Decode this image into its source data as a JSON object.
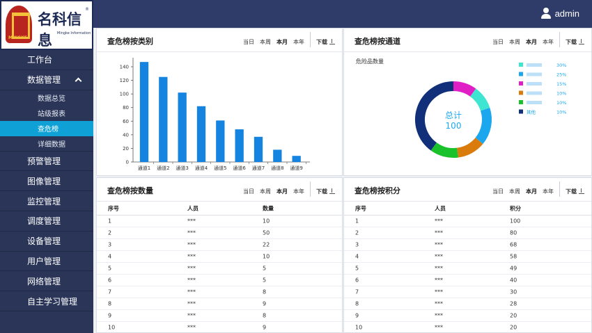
{
  "brand": {
    "name": "名科信息",
    "sub": "Mingke Information",
    "mark": "MINGKE",
    "reg": "®"
  },
  "header": {
    "user": "admin"
  },
  "sidebar": {
    "items": [
      {
        "label": "工作台"
      },
      {
        "label": "数据管理",
        "subs": [
          "数据总览",
          "站级报表",
          "查危榜",
          "详细数据"
        ]
      },
      {
        "label": "预警管理"
      },
      {
        "label": "图像管理"
      },
      {
        "label": "监控管理"
      },
      {
        "label": "调度管理"
      },
      {
        "label": "设备管理"
      },
      {
        "label": "用户管理"
      },
      {
        "label": "网络管理"
      },
      {
        "label": "自主学习管理"
      }
    ]
  },
  "tabs": {
    "today": "当日",
    "week": "本周",
    "month": "本月",
    "year": "本年",
    "download": "下载"
  },
  "panels": {
    "category": {
      "title": "查危榜按类别"
    },
    "channel": {
      "title": "查危榜按通道"
    },
    "count": {
      "title": "查危榜按数量"
    },
    "score": {
      "title": "查危榜按积分"
    }
  },
  "chart_data": [
    {
      "type": "bar",
      "categories": [
        "通道1",
        "通道2",
        "通道3",
        "通道4",
        "通道5",
        "通道6",
        "通道7",
        "通道8",
        "通道9"
      ],
      "values": [
        147,
        125,
        102,
        82,
        61,
        48,
        37,
        18,
        9
      ],
      "ylim": [
        0,
        140
      ],
      "yticks": [
        0,
        20,
        40,
        60,
        80,
        100,
        120,
        140
      ],
      "color": "#1584e0"
    },
    {
      "type": "pie",
      "title": "危险品数量",
      "center_label": "总计",
      "center_value": "100",
      "legend": [
        {
          "name": "",
          "percent": "30%",
          "color": "#3ee6d2"
        },
        {
          "name": "",
          "percent": "25%",
          "color": "#1aa7ee"
        },
        {
          "name": "",
          "percent": "15%",
          "color": "#e020c4"
        },
        {
          "name": "",
          "percent": "10%",
          "color": "#d97b0d"
        },
        {
          "name": "",
          "percent": "10%",
          "color": "#19c12b"
        },
        {
          "name": "其他",
          "percent": "10%",
          "color": "#12307a"
        }
      ],
      "slices": [
        {
          "value": 10,
          "color": "#e020c4"
        },
        {
          "value": 10,
          "color": "#3ee6d2"
        },
        {
          "value": 16,
          "color": "#1aa7ee"
        },
        {
          "value": 12,
          "color": "#d97b0d"
        },
        {
          "value": 12,
          "color": "#19c12b"
        },
        {
          "value": 40,
          "color": "#12307a"
        }
      ]
    }
  ],
  "count_table": {
    "headers": [
      "序号",
      "人员",
      "数量"
    ],
    "rows": [
      [
        "1",
        "***",
        "10"
      ],
      [
        "2",
        "***",
        "50"
      ],
      [
        "3",
        "***",
        "22"
      ],
      [
        "4",
        "***",
        "10"
      ],
      [
        "5",
        "***",
        "5"
      ],
      [
        "6",
        "***",
        "5"
      ],
      [
        "7",
        "***",
        "8"
      ],
      [
        "8",
        "***",
        "9"
      ],
      [
        "9",
        "***",
        "8"
      ],
      [
        "10",
        "***",
        "9"
      ]
    ]
  },
  "score_table": {
    "headers": [
      "序号",
      "人员",
      "积分"
    ],
    "rows": [
      [
        "1",
        "***",
        "100"
      ],
      [
        "2",
        "***",
        "80"
      ],
      [
        "3",
        "***",
        "68"
      ],
      [
        "4",
        "***",
        "58"
      ],
      [
        "5",
        "***",
        "49"
      ],
      [
        "6",
        "***",
        "40"
      ],
      [
        "7",
        "***",
        "30"
      ],
      [
        "8",
        "***",
        "28"
      ],
      [
        "9",
        "***",
        "20"
      ],
      [
        "10",
        "***",
        "20"
      ]
    ]
  }
}
